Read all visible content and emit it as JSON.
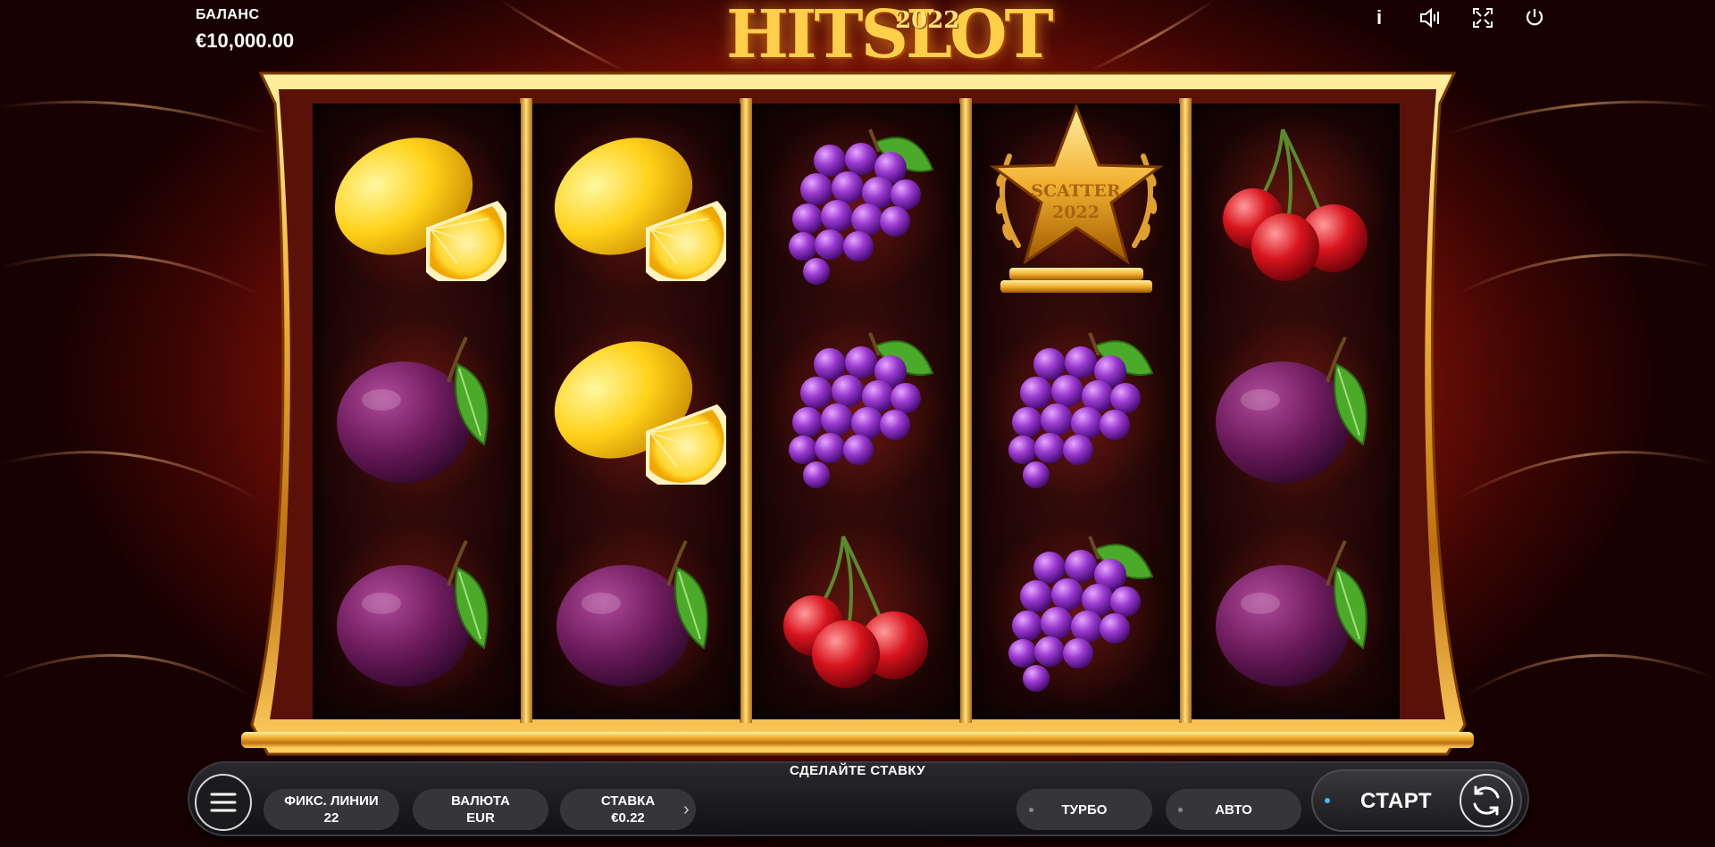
{
  "balance": {
    "label": "БАЛАНС",
    "value": "€10,000.00"
  },
  "logo": {
    "word": "HITSLOT",
    "year": "2022"
  },
  "top_icons": [
    "info-icon",
    "sound-icon",
    "fullscreen-icon",
    "power-icon"
  ],
  "info_glyph": "i",
  "reels": [
    [
      "lemon",
      "plum",
      "plum"
    ],
    [
      "lemon",
      "lemon",
      "plum"
    ],
    [
      "grapes",
      "grapes",
      "cherry"
    ],
    [
      "scatter",
      "grapes",
      "grapes"
    ],
    [
      "cherry",
      "plum",
      "plum"
    ]
  ],
  "scatter": {
    "line1": "SCATTER",
    "line2": "2022"
  },
  "prompt": "СДЕЛАЙТЕ СТАВКУ",
  "controls": {
    "lines_label": "ФИКС. ЛИНИИ",
    "lines_value": "22",
    "currency_label": "ВАЛЮТА",
    "currency_value": "EUR",
    "bet_label": "СТАВКА",
    "bet_value": "€0.22",
    "turbo": "ТУРБО",
    "auto": "АВТО",
    "start": "СТАРТ"
  },
  "colors": {
    "accent_gold": "#ffcf4a",
    "background_red": "#e0300f",
    "start_dot": "#4fb3ff"
  }
}
